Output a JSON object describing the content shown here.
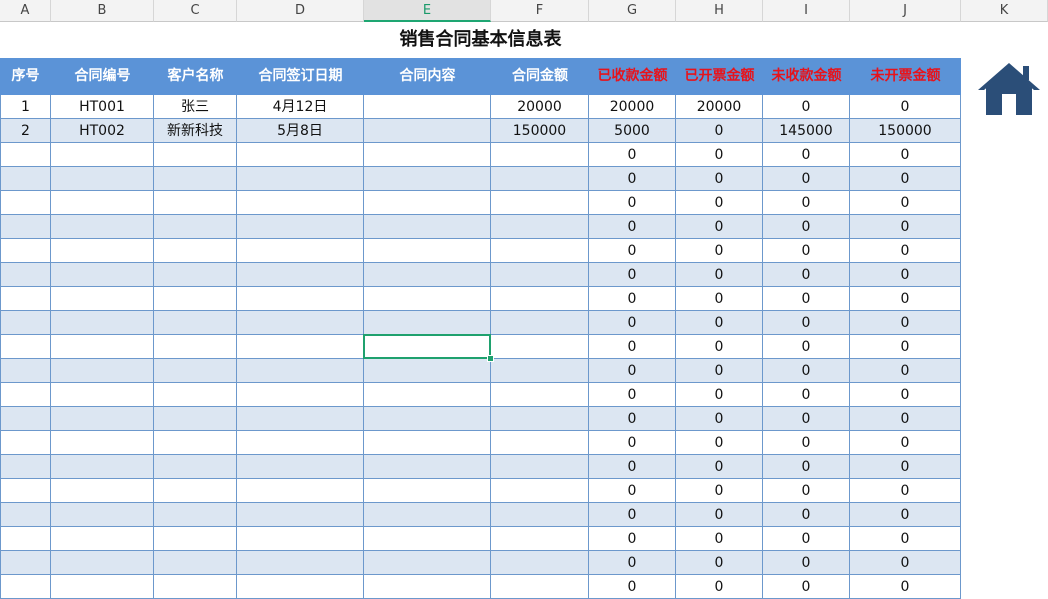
{
  "sheet": {
    "column_letters": [
      "A",
      "B",
      "C",
      "D",
      "E",
      "F",
      "G",
      "H",
      "I",
      "J",
      "K"
    ],
    "selected_column": "E",
    "title": "销售合同基本信息表",
    "headers": [
      "序号",
      "合同编号",
      "客户名称",
      "合同签订日期",
      "合同内容",
      "合同金额",
      "已收款金额",
      "已开票金额",
      "未收款金额",
      "未开票金额"
    ],
    "red_header_indexes": [
      6,
      7,
      8,
      9
    ],
    "rows": [
      [
        "1",
        "HT001",
        "张三",
        "4月12日",
        "",
        "20000",
        "20000",
        "20000",
        "0",
        "0"
      ],
      [
        "2",
        "HT002",
        "新新科技",
        "5月8日",
        "",
        "150000",
        "5000",
        "0",
        "145000",
        "150000"
      ],
      [
        "",
        "",
        "",
        "",
        "",
        "",
        "0",
        "0",
        "0",
        "0"
      ],
      [
        "",
        "",
        "",
        "",
        "",
        "",
        "0",
        "0",
        "0",
        "0"
      ],
      [
        "",
        "",
        "",
        "",
        "",
        "",
        "0",
        "0",
        "0",
        "0"
      ],
      [
        "",
        "",
        "",
        "",
        "",
        "",
        "0",
        "0",
        "0",
        "0"
      ],
      [
        "",
        "",
        "",
        "",
        "",
        "",
        "0",
        "0",
        "0",
        "0"
      ],
      [
        "",
        "",
        "",
        "",
        "",
        "",
        "0",
        "0",
        "0",
        "0"
      ],
      [
        "",
        "",
        "",
        "",
        "",
        "",
        "0",
        "0",
        "0",
        "0"
      ],
      [
        "",
        "",
        "",
        "",
        "",
        "",
        "0",
        "0",
        "0",
        "0"
      ],
      [
        "",
        "",
        "",
        "",
        "",
        "",
        "0",
        "0",
        "0",
        "0"
      ],
      [
        "",
        "",
        "",
        "",
        "",
        "",
        "0",
        "0",
        "0",
        "0"
      ],
      [
        "",
        "",
        "",
        "",
        "",
        "",
        "0",
        "0",
        "0",
        "0"
      ],
      [
        "",
        "",
        "",
        "",
        "",
        "",
        "0",
        "0",
        "0",
        "0"
      ],
      [
        "",
        "",
        "",
        "",
        "",
        "",
        "0",
        "0",
        "0",
        "0"
      ],
      [
        "",
        "",
        "",
        "",
        "",
        "",
        "0",
        "0",
        "0",
        "0"
      ],
      [
        "",
        "",
        "",
        "",
        "",
        "",
        "0",
        "0",
        "0",
        "0"
      ],
      [
        "",
        "",
        "",
        "",
        "",
        "",
        "0",
        "0",
        "0",
        "0"
      ],
      [
        "",
        "",
        "",
        "",
        "",
        "",
        "0",
        "0",
        "0",
        "0"
      ],
      [
        "",
        "",
        "",
        "",
        "",
        "",
        "0",
        "0",
        "0",
        "0"
      ],
      [
        "",
        "",
        "",
        "",
        "",
        "",
        "0",
        "0",
        "0",
        "0"
      ]
    ],
    "active_cell": {
      "column": "E",
      "row_index": 10
    }
  },
  "colors": {
    "header_bg": "#5b93d7",
    "header_text": "#ffffff",
    "header_red_text": "#e8131b",
    "alt_row_bg": "#dce6f2",
    "grid_line": "#6c98cc",
    "active_cell_border": "#1fa16e",
    "home_icon": "#2b4e78"
  },
  "home_icon": {
    "name": "home-icon"
  }
}
